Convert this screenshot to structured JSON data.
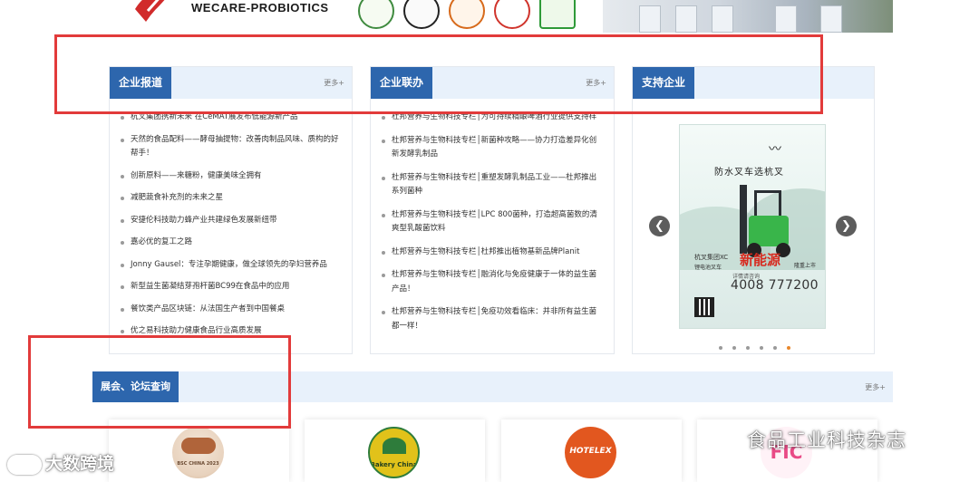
{
  "banner": {
    "brand": "WECARE-PROBIOTICS"
  },
  "panels": [
    {
      "title": "企业报道",
      "more": "更多+",
      "items": [
        "杭叉集团携新未来 在CeMAT展发布低能源新产品",
        "天然的食品配料——酵母抽提物：改善肉制品风味、质构的好帮手！",
        "创新原料——来糖粉，健康美味全拥有",
        "减肥蔬食补充剂的未来之星",
        "安捷伦科技助力蜂产业共建绿色发展新纽带",
        "嘉必优的复工之路",
        "Jonny Gausel：专注孕期健康，做全球领先的孕妇营养品",
        "新型益生菌凝结芽孢杆菌BC99在食品中的应用",
        "餐饮类产品区块链：从法国生产者到中国餐桌",
        "优之易科技助力健康食品行业高质发展"
      ]
    },
    {
      "title": "企业联办",
      "more": "更多+",
      "items": [
        "杜邦营养与生物科技专栏│为可持续精酿啤酒行业提供支持样",
        "杜邦营养与生物科技专栏│新菌种攻略——协力打造差异化创新发酵乳制品",
        "杜邦营养与生物科技专栏│重塑发酵乳制品工业——杜邦推出系列菌种",
        "杜邦营养与生物科技专栏│LPC 800菌种，打造超高菌数的清爽型乳酸菌饮料",
        "杜邦营养与生物科技专栏│杜邦推出植物基新品牌Planit",
        "杜邦营养与生物科技专栏│融消化与免疫健康于一体的益生菌产品！",
        "杜邦营养与生物科技专栏│免疫功效看临床：并非所有益生菌都一样！"
      ]
    },
    {
      "title": "支持企业",
      "ad": {
        "slogan": "防水叉车选杭叉",
        "brand_line": "杭叉集团XC",
        "sub_line": "锂电池叉车",
        "headline": "新能源",
        "launch": "隆重上市",
        "hotline_label": "详情请咨询",
        "phone": "4008 777200"
      },
      "slides": 6,
      "active_slide": 6,
      "prev_icon": "chevron-left-icon",
      "next_icon": "chevron-right-icon"
    }
  ],
  "section": {
    "title": "展会、论坛查询",
    "more": "更多+"
  },
  "cards": [
    {
      "name": "bakery-china-2023",
      "label": "BSC CHINA 2023",
      "color": "#b0643a"
    },
    {
      "name": "bakery-china",
      "label": "Bakery China",
      "color": "#e1c21a"
    },
    {
      "name": "hotelex",
      "label": "HOTELEX",
      "color": "#e2571f"
    },
    {
      "name": "fic",
      "label": "FIC",
      "color": "#e94a86"
    }
  ],
  "watermarks": {
    "left": "大数跨境",
    "right": "食品工业科技杂志"
  }
}
